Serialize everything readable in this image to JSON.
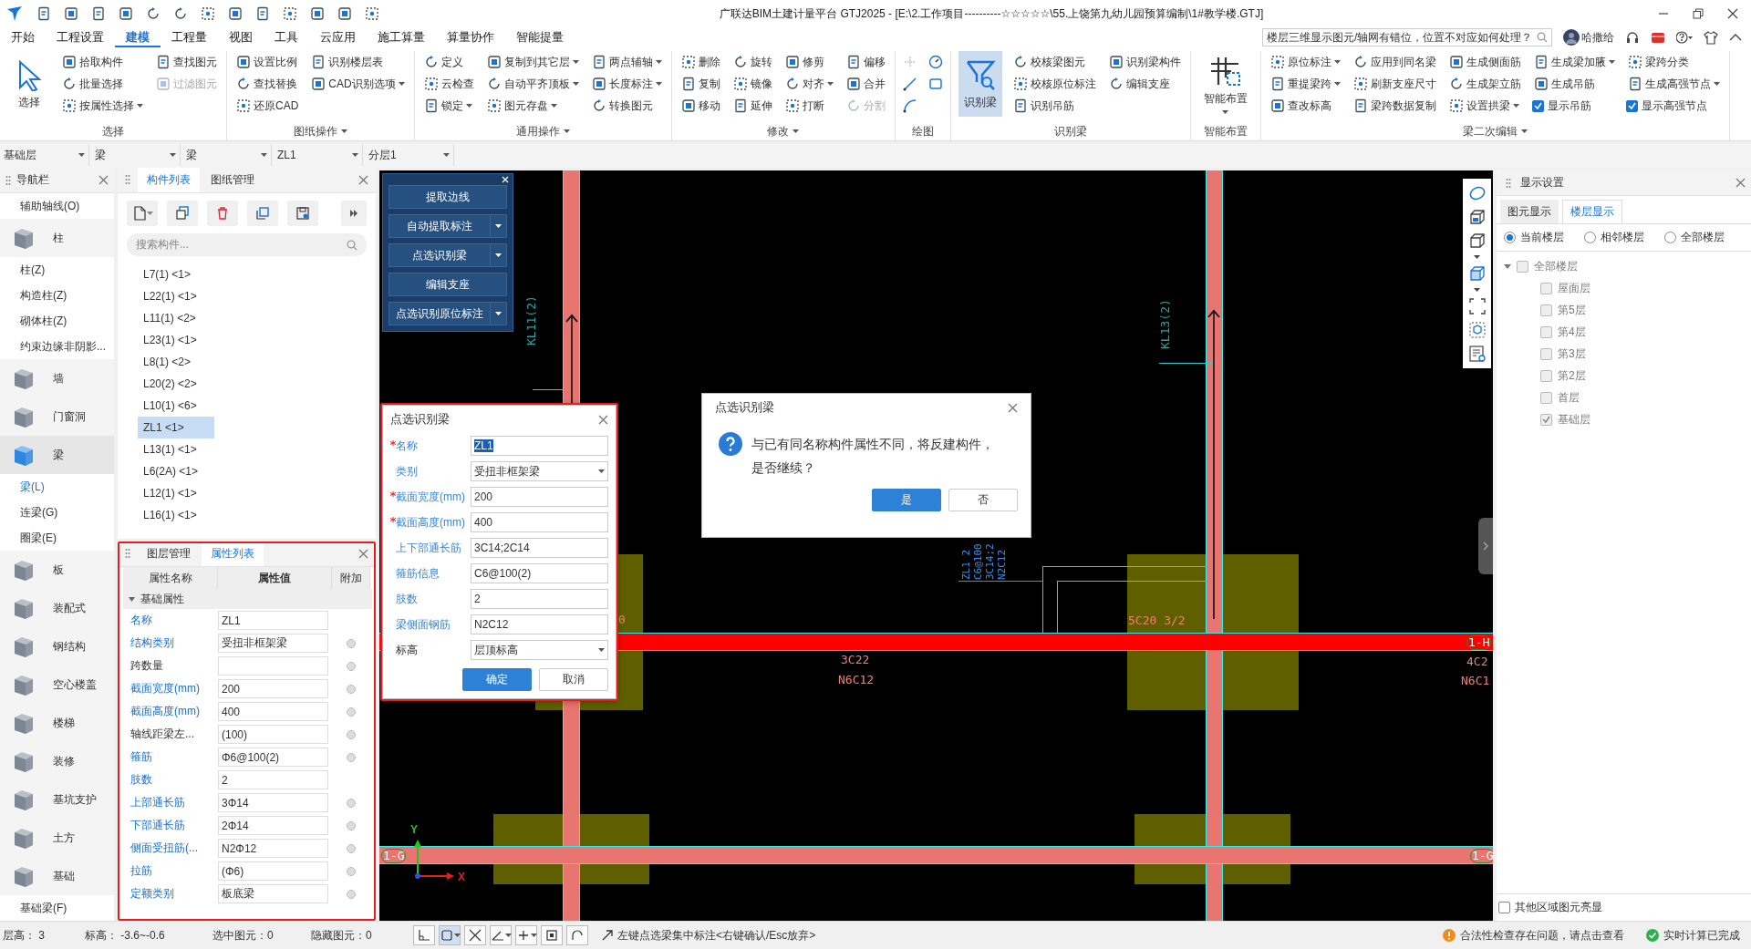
{
  "title_bar": {
    "title": "广联达BIM土建计量平台 GTJ2025 - [E:\\2.工作项目----------☆☆☆☆☆\\55.上饶第九幼儿园预算编制\\1#教学楼.GTJ]"
  },
  "menu_tabs": [
    {
      "label": "开始",
      "selected": false
    },
    {
      "label": "工程设置",
      "selected": false
    },
    {
      "label": "建模",
      "selected": true
    },
    {
      "label": "工程量",
      "selected": false
    },
    {
      "label": "视图",
      "selected": false
    },
    {
      "label": "工具",
      "selected": false
    },
    {
      "label": "云应用",
      "selected": false
    },
    {
      "label": "施工算量",
      "selected": false
    },
    {
      "label": "算量协作",
      "selected": false
    },
    {
      "label": "智能提量",
      "selected": false
    }
  ],
  "help_search": {
    "value": "楼层三维显示图元/轴网有错位，位置不对应如何处理？"
  },
  "user": {
    "name": "哈撒给"
  },
  "ribbon": [
    {
      "title": "选择",
      "dropdown": false,
      "kind": "tools",
      "items": [
        {
          "label": "选择",
          "kind": "large",
          "dropdown": false,
          "active": false,
          "disabled": false
        },
        {
          "label": "拾取构件",
          "kind": "small",
          "dropdown": false,
          "active": false,
          "disabled": false
        },
        {
          "label": "批量选择",
          "kind": "small",
          "dropdown": false,
          "active": false,
          "disabled": false
        },
        {
          "label": "按属性选择",
          "kind": "small",
          "dropdown": true,
          "active": false,
          "disabled": false
        },
        {
          "label": "查找图元",
          "kind": "small",
          "dropdown": false,
          "active": false,
          "disabled": false
        },
        {
          "label": "过滤图元",
          "kind": "small",
          "dropdown": false,
          "active": false,
          "disabled": true
        }
      ]
    },
    {
      "title": "图纸操作",
      "dropdown": true,
      "kind": "tools",
      "items": [
        {
          "label": "设置比例",
          "kind": "small",
          "dropdown": false,
          "active": false,
          "disabled": false
        },
        {
          "label": "查找替换",
          "kind": "small",
          "dropdown": false,
          "active": false,
          "disabled": false
        },
        {
          "label": "还原CAD",
          "kind": "small",
          "dropdown": false,
          "active": false,
          "disabled": false
        },
        {
          "label": "识别楼层表",
          "kind": "small",
          "dropdown": false,
          "active": false,
          "disabled": false
        },
        {
          "label": "CAD识别选项",
          "kind": "small",
          "dropdown": true,
          "active": false,
          "disabled": false
        }
      ]
    },
    {
      "title": "通用操作",
      "dropdown": true,
      "kind": "tools",
      "items": [
        {
          "label": "定义",
          "kind": "small",
          "dropdown": false,
          "active": false,
          "disabled": false
        },
        {
          "label": "云检查",
          "kind": "small",
          "dropdown": false,
          "active": false,
          "disabled": false
        },
        {
          "label": "锁定",
          "kind": "small",
          "dropdown": true,
          "active": false,
          "disabled": false
        },
        {
          "label": "复制到其它层",
          "kind": "small",
          "dropdown": true,
          "active": false,
          "disabled": false
        },
        {
          "label": "自动平齐顶板",
          "kind": "small",
          "dropdown": true,
          "active": false,
          "disabled": false
        },
        {
          "label": "图元存盘",
          "kind": "small",
          "dropdown": true,
          "active": false,
          "disabled": false
        },
        {
          "label": "两点辅轴",
          "kind": "small",
          "dropdown": true,
          "active": false,
          "disabled": false
        },
        {
          "label": "长度标注",
          "kind": "small",
          "dropdown": true,
          "active": false,
          "disabled": false
        },
        {
          "label": "转换图元",
          "kind": "small",
          "dropdown": false,
          "active": false,
          "disabled": false
        }
      ]
    },
    {
      "title": "修改",
      "dropdown": true,
      "kind": "tools",
      "items": [
        {
          "label": "删除",
          "kind": "small",
          "dropdown": false,
          "active": false,
          "disabled": false
        },
        {
          "label": "复制",
          "kind": "small",
          "dropdown": false,
          "active": false,
          "disabled": false
        },
        {
          "label": "移动",
          "kind": "small",
          "dropdown": false,
          "active": false,
          "disabled": false
        },
        {
          "label": "旋转",
          "kind": "small",
          "dropdown": false,
          "active": false,
          "disabled": false
        },
        {
          "label": "镜像",
          "kind": "small",
          "dropdown": false,
          "active": false,
          "disabled": false
        },
        {
          "label": "延伸",
          "kind": "small",
          "dropdown": false,
          "active": false,
          "disabled": false
        },
        {
          "label": "修剪",
          "kind": "small",
          "dropdown": false,
          "active": false,
          "disabled": false
        },
        {
          "label": "对齐",
          "kind": "small",
          "dropdown": true,
          "active": false,
          "disabled": false
        },
        {
          "label": "打断",
          "kind": "small",
          "dropdown": false,
          "active": false,
          "disabled": false
        },
        {
          "label": "偏移",
          "kind": "small",
          "dropdown": false,
          "active": false,
          "disabled": false
        },
        {
          "label": "合并",
          "kind": "small",
          "dropdown": false,
          "active": false,
          "disabled": false
        },
        {
          "label": "分割",
          "kind": "small",
          "dropdown": false,
          "active": false,
          "disabled": true
        }
      ]
    },
    {
      "title": "绘图",
      "dropdown": false,
      "kind": "draw_tools"
    },
    {
      "title": "识别梁",
      "dropdown": false,
      "kind": "tools",
      "items": [
        {
          "label": "识别梁",
          "kind": "large",
          "dropdown": false,
          "active": true,
          "disabled": false
        },
        {
          "label": "校核梁图元",
          "kind": "small",
          "dropdown": false,
          "active": false,
          "disabled": false
        },
        {
          "label": "校核原位标注",
          "kind": "small",
          "dropdown": false,
          "active": false,
          "disabled": false
        },
        {
          "label": "识别吊筋",
          "kind": "small",
          "dropdown": false,
          "active": false,
          "disabled": false
        },
        {
          "label": "识别梁构件",
          "kind": "small",
          "dropdown": false,
          "active": false,
          "disabled": false
        },
        {
          "label": "编辑支座",
          "kind": "small",
          "dropdown": false,
          "active": false,
          "disabled": false
        }
      ]
    },
    {
      "title": "智能布置",
      "dropdown": false,
      "kind": "tools",
      "items": [
        {
          "label": "智能布置",
          "kind": "large",
          "dropdown": true,
          "active": false,
          "disabled": false
        }
      ]
    },
    {
      "title": "梁二次编辑",
      "dropdown": true,
      "kind": "tools",
      "items": [
        {
          "label": "原位标注",
          "kind": "small",
          "dropdown": true,
          "active": false,
          "disabled": false
        },
        {
          "label": "重提梁跨",
          "kind": "small",
          "dropdown": true,
          "active": false,
          "disabled": false
        },
        {
          "label": "查改标高",
          "kind": "small",
          "dropdown": false,
          "active": false,
          "disabled": false
        },
        {
          "label": "应用到同名梁",
          "kind": "small",
          "dropdown": false,
          "active": false,
          "disabled": false
        },
        {
          "label": "刷新支座尺寸",
          "kind": "small",
          "dropdown": false,
          "active": false,
          "disabled": false
        },
        {
          "label": "梁跨数据复制",
          "kind": "small",
          "dropdown": false,
          "active": false,
          "disabled": false
        },
        {
          "label": "生成侧面筋",
          "kind": "small",
          "dropdown": false,
          "active": false,
          "disabled": false
        },
        {
          "label": "生成架立筋",
          "kind": "small",
          "dropdown": false,
          "active": false,
          "disabled": false
        },
        {
          "label": "设置拱梁",
          "kind": "small",
          "dropdown": true,
          "active": false,
          "disabled": false
        },
        {
          "label": "生成梁加腋",
          "kind": "small",
          "dropdown": true,
          "active": false,
          "disabled": false
        },
        {
          "label": "生成吊筋",
          "kind": "small",
          "dropdown": false,
          "active": false,
          "disabled": false
        },
        {
          "label": "显示吊筋",
          "kind": "check",
          "checked": true
        },
        {
          "label": "梁跨分类",
          "kind": "small",
          "dropdown": false,
          "active": false,
          "disabled": false
        },
        {
          "label": "生成高强节点",
          "kind": "small",
          "dropdown": true,
          "active": false,
          "disabled": false
        },
        {
          "label": "显示高强节点",
          "kind": "check",
          "checked": true
        }
      ]
    }
  ],
  "selectors": [
    {
      "value": "基础层"
    },
    {
      "value": "梁"
    },
    {
      "value": "梁"
    },
    {
      "value": "ZL1"
    },
    {
      "value": "分层1"
    }
  ],
  "navigator": {
    "title": "导航栏",
    "items": [
      {
        "kind": "sub",
        "label": "辅助轴线(O)",
        "selected": false
      },
      {
        "kind": "category",
        "label": "柱",
        "selected": false
      },
      {
        "kind": "sub",
        "label": "柱(Z)",
        "selected": false
      },
      {
        "kind": "sub",
        "label": "构造柱(Z)",
        "selected": false
      },
      {
        "kind": "sub",
        "label": "砌体柱(Z)",
        "selected": false
      },
      {
        "kind": "sub",
        "label": "约束边缘非阴影...",
        "selected": false
      },
      {
        "kind": "category",
        "label": "墙",
        "selected": false
      },
      {
        "kind": "category",
        "label": "门窗洞",
        "selected": false
      },
      {
        "kind": "category",
        "label": "梁",
        "selected": true
      },
      {
        "kind": "sub",
        "label": "梁(L)",
        "selected": true
      },
      {
        "kind": "sub",
        "label": "连梁(G)",
        "selected": false
      },
      {
        "kind": "sub",
        "label": "圈梁(E)",
        "selected": false
      },
      {
        "kind": "category",
        "label": "板",
        "selected": false
      },
      {
        "kind": "category",
        "label": "装配式",
        "selected": false
      },
      {
        "kind": "category",
        "label": "钢结构",
        "selected": false
      },
      {
        "kind": "category",
        "label": "空心楼盖",
        "selected": false
      },
      {
        "kind": "category",
        "label": "楼梯",
        "selected": false
      },
      {
        "kind": "category",
        "label": "装修",
        "selected": false
      },
      {
        "kind": "category",
        "label": "基坑支护",
        "selected": false
      },
      {
        "kind": "category",
        "label": "土方",
        "selected": false
      },
      {
        "kind": "category",
        "label": "基础",
        "selected": false
      },
      {
        "kind": "sub",
        "label": "基础梁(F)",
        "selected": false
      }
    ]
  },
  "component_list": {
    "tabs": [
      {
        "label": "构件列表",
        "selected": true
      },
      {
        "label": "图纸管理",
        "selected": false
      }
    ],
    "search": {
      "placeholder": "搜索构件..."
    },
    "items": [
      {
        "label": "L7(1) <1>",
        "selected": false
      },
      {
        "label": "L22(1) <1>",
        "selected": false
      },
      {
        "label": "L11(1) <2>",
        "selected": false
      },
      {
        "label": "L23(1) <1>",
        "selected": false
      },
      {
        "label": "L8(1) <2>",
        "selected": false
      },
      {
        "label": "L20(2) <2>",
        "selected": false
      },
      {
        "label": "L10(1) <6>",
        "selected": false
      },
      {
        "label": "ZL1 <1>",
        "selected": true
      },
      {
        "label": "L13(1) <1>",
        "selected": false
      },
      {
        "label": "L6(2A) <1>",
        "selected": false
      },
      {
        "label": "L12(1) <1>",
        "selected": false
      },
      {
        "label": "L16(1) <1>",
        "selected": false
      }
    ]
  },
  "properties": {
    "highlighted": true,
    "tabs": [
      {
        "label": "图层管理",
        "selected": false
      },
      {
        "label": "属性列表",
        "selected": true
      }
    ],
    "columns": [
      "属性名称",
      "属性值",
      "附加"
    ],
    "group": {
      "label": "基础属性",
      "expanded": true
    },
    "rows": [
      {
        "name": "名称",
        "value": "ZL1",
        "emphasized": true,
        "attached": false
      },
      {
        "name": "结构类别",
        "value": "受扭非框架梁",
        "emphasized": true,
        "attached": true
      },
      {
        "name": "跨数量",
        "emphasized": false,
        "attached": true
      },
      {
        "name": "截面宽度(mm)",
        "value": "200",
        "emphasized": true,
        "attached": true
      },
      {
        "name": "截面高度(mm)",
        "value": "400",
        "emphasized": true,
        "attached": true
      },
      {
        "name": "轴线距梁左...",
        "value": "(100)",
        "emphasized": false,
        "attached": true
      },
      {
        "name": "箍筋",
        "value": "Φ6@100(2)",
        "emphasized": true,
        "attached": true
      },
      {
        "name": "肢数",
        "value": "2",
        "emphasized": true,
        "attached": false
      },
      {
        "name": "上部通长筋",
        "value": "3Φ14",
        "emphasized": true,
        "attached": true
      },
      {
        "name": "下部通长筋",
        "value": "2Φ14",
        "emphasized": true,
        "attached": true
      },
      {
        "name": "侧面受扭筋(...",
        "value": "N2Φ12",
        "emphasized": true,
        "attached": true
      },
      {
        "name": "拉筋",
        "value": "(Φ6)",
        "emphasized": true,
        "attached": true
      },
      {
        "name": "定额类别",
        "value": "板底梁",
        "emphasized": true,
        "attached": true
      }
    ]
  },
  "canvas": {
    "tool_panel": {
      "buttons": [
        {
          "label": "提取边线",
          "dropdown": false
        },
        {
          "label": "自动提取标注",
          "dropdown": true
        },
        {
          "label": "点选识别梁",
          "dropdown": true
        },
        {
          "label": "编辑支座",
          "dropdown": false
        },
        {
          "label": "点选识别原位标注",
          "dropdown": true
        }
      ]
    },
    "labels": [
      {
        "text": "KL11(2)",
        "kind": "beam_name"
      },
      {
        "text": "KL13(2)",
        "kind": "beam_name"
      },
      {
        "text": "ZL1 2",
        "kind": "beam_note"
      },
      {
        "text": "C6@100",
        "kind": "beam_note"
      },
      {
        "text": "3C14;2",
        "kind": "beam_note"
      },
      {
        "text": "N2C12",
        "kind": "beam_note"
      },
      {
        "text": "0",
        "kind": "rebar"
      },
      {
        "text": "5C20 3/2",
        "kind": "rebar"
      },
      {
        "text": "3C22",
        "kind": "rebar"
      },
      {
        "text": "N6C12",
        "kind": "rebar"
      },
      {
        "text": "1-H",
        "kind": "axis"
      },
      {
        "text": "4C2",
        "kind": "rebar"
      },
      {
        "text": "N6C1",
        "kind": "rebar"
      },
      {
        "text": "1-G",
        "kind": "axis"
      },
      {
        "text": "1-G",
        "kind": "axis"
      }
    ],
    "axes": {
      "x": "X",
      "y": "Y"
    }
  },
  "beam_dialog": {
    "title": "点选识别梁",
    "highlighted": true,
    "fields": [
      {
        "label": "名称",
        "required": true,
        "emphasized": true,
        "kind": "text",
        "value": "ZL1",
        "value_selected": true
      },
      {
        "label": "类别",
        "required": false,
        "emphasized": true,
        "kind": "select",
        "value": "受扭非框架梁",
        "value_selected": false
      },
      {
        "label": "截面宽度(mm)",
        "required": true,
        "emphasized": true,
        "kind": "text",
        "value": "200",
        "value_selected": false
      },
      {
        "label": "截面高度(mm)",
        "required": true,
        "emphasized": true,
        "kind": "text",
        "value": "400",
        "value_selected": false
      },
      {
        "label": "上下部通长筋",
        "required": false,
        "emphasized": true,
        "kind": "text",
        "value": "3C14;2C14",
        "value_selected": false
      },
      {
        "label": "箍筋信息",
        "required": false,
        "emphasized": true,
        "kind": "text",
        "value": "C6@100(2)",
        "value_selected": false
      },
      {
        "label": "肢数",
        "required": false,
        "emphasized": true,
        "kind": "text",
        "value": "2",
        "value_selected": false
      },
      {
        "label": "梁侧面钢筋",
        "required": false,
        "emphasized": true,
        "kind": "text",
        "value": "N2C12",
        "value_selected": false
      },
      {
        "label": "标高",
        "required": false,
        "emphasized": false,
        "kind": "select",
        "value": "层顶标高",
        "value_selected": false
      }
    ],
    "buttons": [
      {
        "label": "确定",
        "primary": true
      },
      {
        "label": "取消",
        "primary": false
      }
    ]
  },
  "confirm_dialog": {
    "title": "点选识别梁",
    "message": "与已有同名称构件属性不同，将反建构件，是否继续？",
    "buttons": [
      {
        "label": "是",
        "primary": true
      },
      {
        "label": "否",
        "primary": false
      }
    ]
  },
  "display_settings": {
    "title": "显示设置",
    "tabs": [
      {
        "label": "图元显示",
        "selected": false
      },
      {
        "label": "楼层显示",
        "selected": true
      }
    ],
    "scope": [
      {
        "label": "当前楼层",
        "selected": true
      },
      {
        "label": "相邻楼层",
        "selected": false
      },
      {
        "label": "全部楼层",
        "selected": false
      }
    ],
    "tree": [
      {
        "label": "全部楼层",
        "checked": false,
        "expanded": true,
        "children": [
          {
            "label": "屋面层",
            "checked": false
          },
          {
            "label": "第5层",
            "checked": false
          },
          {
            "label": "第4层",
            "checked": false
          },
          {
            "label": "第3层",
            "checked": false
          },
          {
            "label": "第2层",
            "checked": false
          },
          {
            "label": "首层",
            "checked": false
          },
          {
            "label": "基础层",
            "checked": true
          }
        ]
      }
    ],
    "footer_option": {
      "label": "其他区域图元亮显",
      "checked": false
    }
  },
  "status_bar": {
    "fields": [
      "层高： 3",
      "标高： -3.6~-0.6",
      "选中图元：0",
      "隐藏图元：0"
    ],
    "hint": "左键点选梁集中标注<右键确认/Esc放弃>",
    "notices": [
      {
        "kind": "warning",
        "text": "合法性检查存在问题，请点击查看"
      },
      {
        "kind": "ok",
        "text": "实时计算已完成"
      }
    ]
  }
}
